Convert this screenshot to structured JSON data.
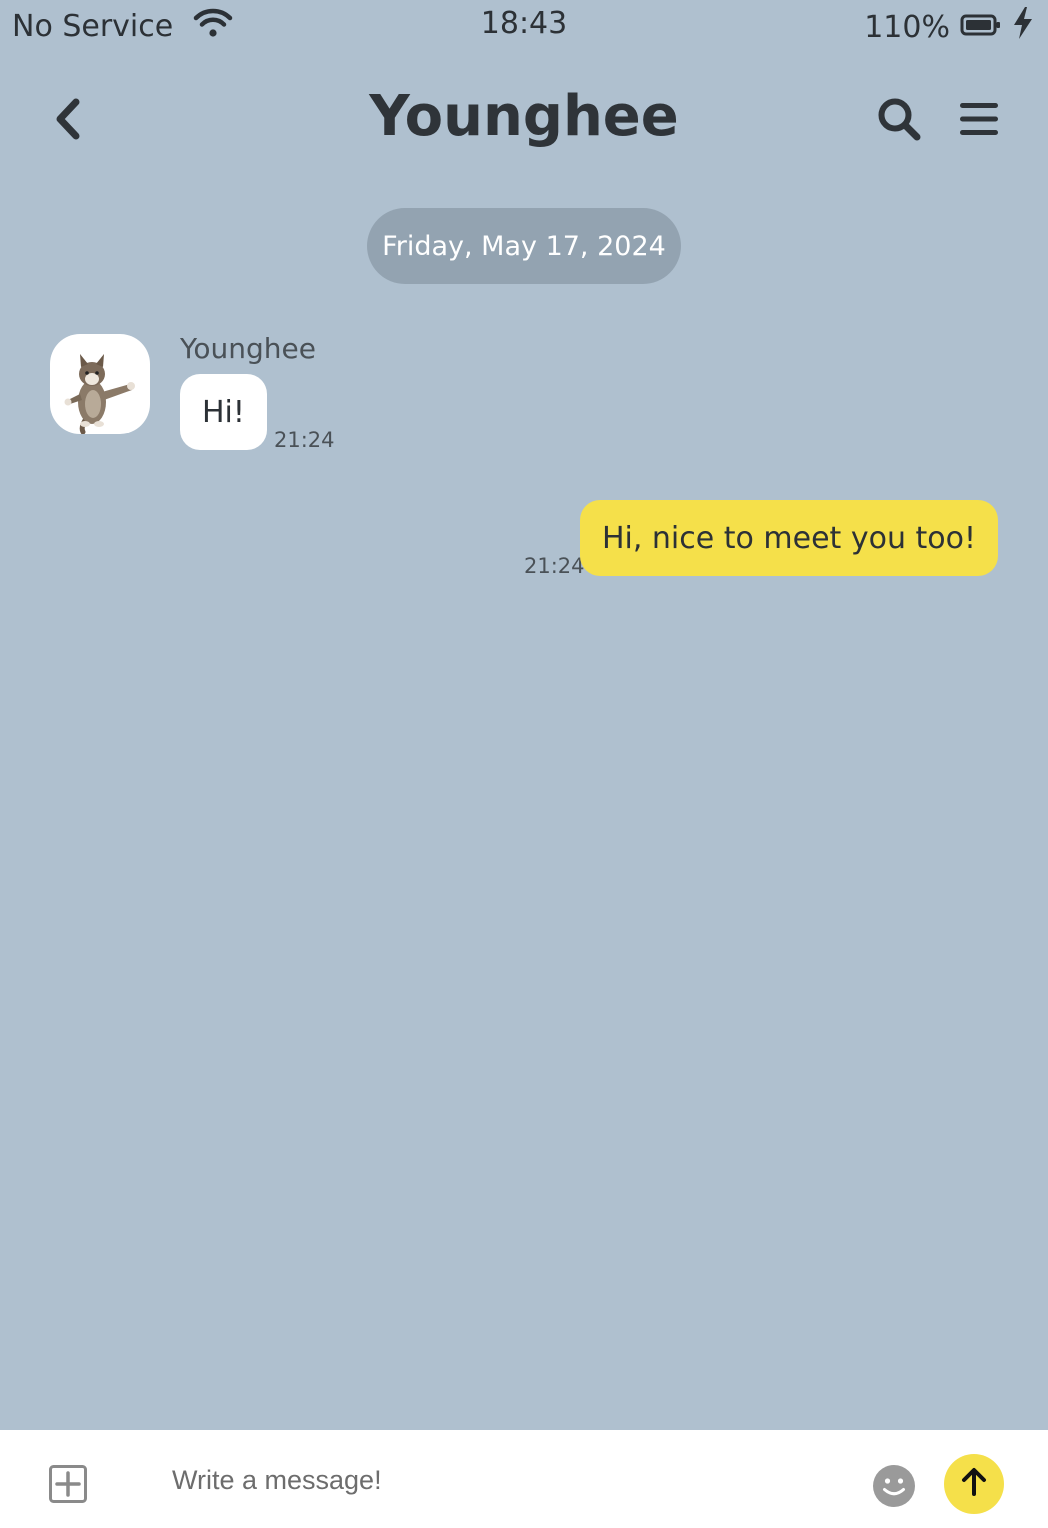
{
  "status_bar": {
    "carrier": "No Service",
    "time": "18:43",
    "battery": "110%",
    "wifi_icon": "wifi-icon",
    "battery_icon": "battery-icon",
    "charging_icon": "bolt-icon"
  },
  "header": {
    "title": "Younghee",
    "back_icon": "chevron-left-icon",
    "search_icon": "search-icon",
    "menu_icon": "menu-icon"
  },
  "chat": {
    "date_divider": "Friday, May 17, 2024",
    "messages": [
      {
        "direction": "incoming",
        "sender": "Younghee",
        "text": "Hi!",
        "time": "21:24",
        "avatar": "cat-avatar"
      },
      {
        "direction": "outgoing",
        "text": "Hi, nice to meet you too!",
        "time": "21:24"
      }
    ]
  },
  "composer": {
    "placeholder": "Write a message!",
    "value": "",
    "attach_icon": "plus-square-icon",
    "emoji_icon": "smiley-icon",
    "send_icon": "arrow-up-icon"
  },
  "colors": {
    "background": "#afc0cf",
    "date_pill": "#93a3b1",
    "outgoing_bubble": "#f5e04a",
    "incoming_bubble": "#ffffff",
    "send_button": "#f5e04a",
    "text": "#2c3136"
  }
}
